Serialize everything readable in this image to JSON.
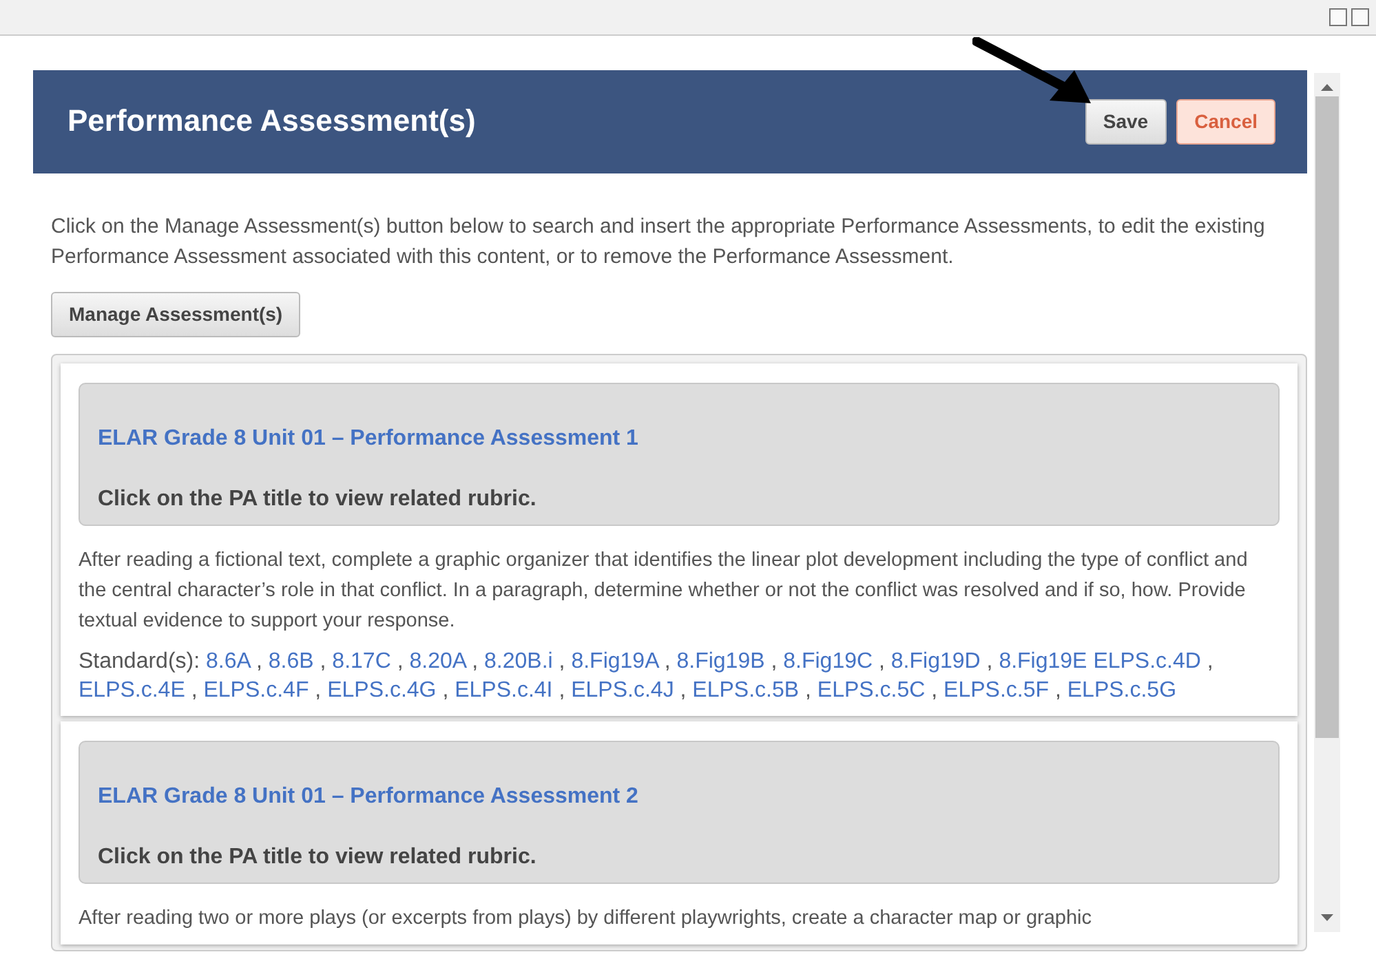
{
  "header": {
    "title": "Performance Assessment(s)",
    "buttons": [
      {
        "label": "Save",
        "kind": "default"
      },
      {
        "label": "Cancel",
        "kind": "cancel"
      }
    ]
  },
  "intro": "Click on the Manage Assessment(s) button below to search and insert the appropriate Performance Assessments, to edit the existing Performance Assessment associated with this content, or to remove the Performance Assessment.",
  "manage_button": "Manage Assessment(s)",
  "assessments": [
    {
      "title": "ELAR Grade 8 Unit 01 – Performance Assessment 1",
      "hint": "Click on the PA title to view related rubric.",
      "description": "After reading a fictional text, complete a graphic organizer that identifies the linear plot development including the type of conflict and the central character’s role in that conflict.  In a paragraph, determine whether or not the conflict was resolved and if so, how. Provide textual evidence to support your response.",
      "standards_label": "Standard(s):",
      "standards": [
        {
          "code": "8.6A",
          "separator": ","
        },
        {
          "code": "8.6B",
          "separator": ","
        },
        {
          "code": "8.17C",
          "separator": ","
        },
        {
          "code": "8.20A",
          "separator": ","
        },
        {
          "code": "8.20B.i",
          "separator": ","
        },
        {
          "code": "8.Fig19A",
          "separator": ","
        },
        {
          "code": "8.Fig19B",
          "separator": ","
        },
        {
          "code": "8.Fig19C",
          "separator": ","
        },
        {
          "code": "8.Fig19D",
          "separator": ","
        },
        {
          "code": "8.Fig19E"
        },
        {
          "code": "ELPS.c.4D",
          "separator": ","
        },
        {
          "code": "ELPS.c.4E",
          "separator": ","
        },
        {
          "code": "ELPS.c.4F",
          "separator": ","
        },
        {
          "code": "ELPS.c.4G",
          "separator": ","
        },
        {
          "code": "ELPS.c.4I",
          "separator": ","
        },
        {
          "code": "ELPS.c.4J",
          "separator": ","
        },
        {
          "code": "ELPS.c.5B",
          "separator": ","
        },
        {
          "code": "ELPS.c.5C",
          "separator": ","
        },
        {
          "code": "ELPS.c.5F",
          "separator": ","
        },
        {
          "code": "ELPS.c.5G"
        }
      ]
    },
    {
      "title": "ELAR Grade 8 Unit 01 – Performance Assessment 2",
      "hint": "Click on the PA title to view related rubric.",
      "description": "After reading two or more plays (or excerpts from plays) by different playwrights, create a character map or graphic"
    }
  ]
}
